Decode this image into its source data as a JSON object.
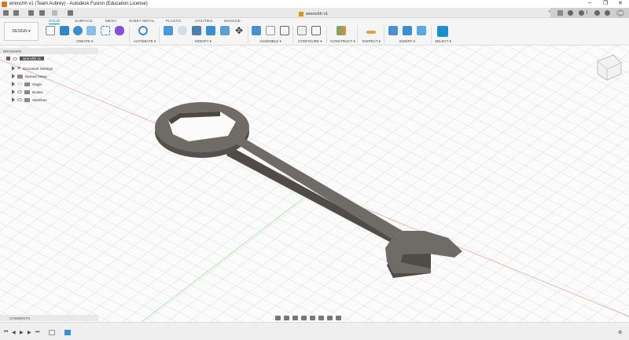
{
  "window": {
    "title": "wrenchh v1 (Team Aubrey) - Autodesk Fusion (Education License)",
    "minimize": "–",
    "restore": "❐",
    "close": "✕"
  },
  "document_tab": {
    "label": "wrenchh v1",
    "close": "×"
  },
  "user_initials": "AH",
  "notifications_count": "1",
  "workspace": "DESIGN ▾",
  "tabs": [
    "SOLID",
    "SURFACE",
    "MESH",
    "SHEET METAL",
    "PLASTIC",
    "UTILITIES",
    "MANAGE"
  ],
  "groups": [
    "CREATE ▾",
    "AUTOMATE ▾",
    "MODIFY ▾",
    "ASSEMBLE ▾",
    "CONFIGURE ▾",
    "CONSTRUCT ▾",
    "INSPECT ▾",
    "INSERT ▾",
    "SELECT ▾"
  ],
  "browser": {
    "title": "BROWSER",
    "root": "wrenchh v1",
    "items": [
      "Document Settings",
      "Named Views",
      "Origin",
      "Bodies",
      "Sketches"
    ]
  },
  "comments": "COMMENTS",
  "colors": {
    "accent": "#1d8fcf",
    "model": "#6f6b66"
  }
}
